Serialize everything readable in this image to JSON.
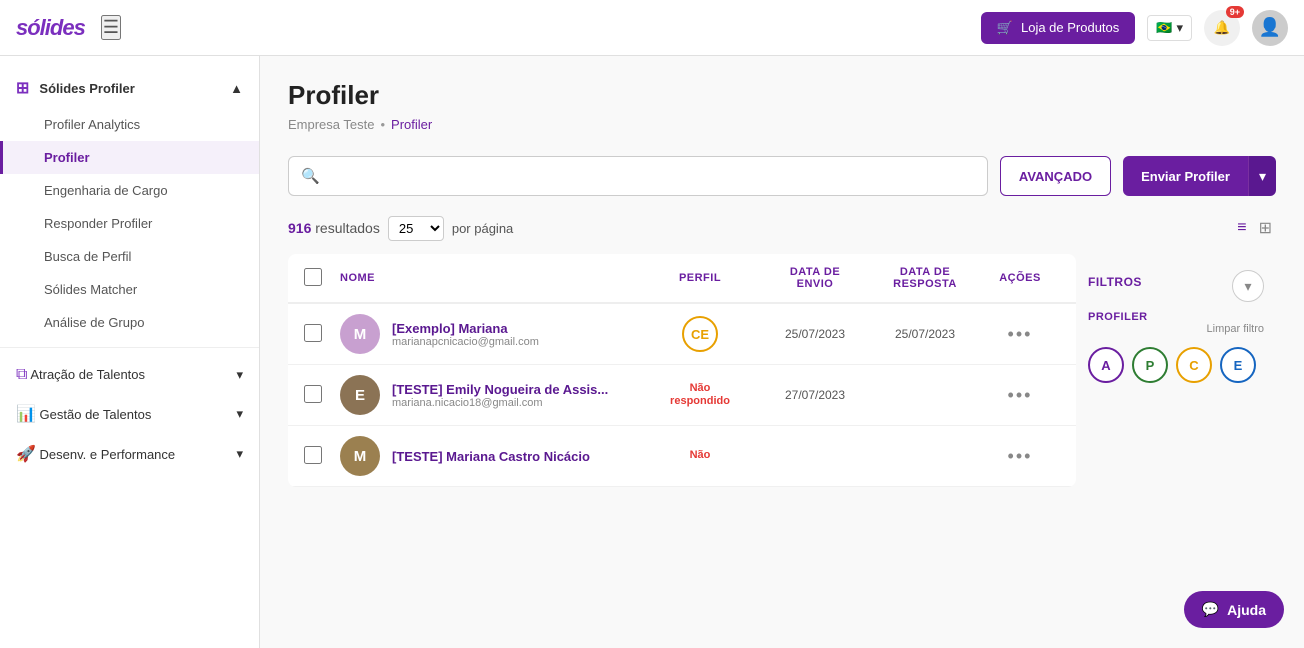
{
  "header": {
    "logo": "sólides",
    "menu_label": "☰",
    "shop_button": "Loja de Produtos",
    "flag_emoji": "🇧🇷",
    "notif_badge": "9+",
    "cursor_icon": "↖"
  },
  "sidebar": {
    "solides_profiler_label": "Sólides Profiler",
    "items": [
      {
        "id": "profiler-analytics",
        "label": "Profiler Analytics",
        "active": false
      },
      {
        "id": "profiler",
        "label": "Profiler",
        "active": true
      },
      {
        "id": "engenharia-de-cargo",
        "label": "Engenharia de Cargo",
        "active": false
      },
      {
        "id": "responder-profiler",
        "label": "Responder Profiler",
        "active": false
      },
      {
        "id": "busca-de-perfil",
        "label": "Busca de Perfil",
        "active": false
      },
      {
        "id": "solides-matcher",
        "label": "Sólides Matcher",
        "active": false
      },
      {
        "id": "analise-de-grupo",
        "label": "Análise de Grupo",
        "active": false
      }
    ],
    "sections": [
      {
        "id": "atracao-de-talentos",
        "label": "Atração de Talentos"
      },
      {
        "id": "gestao-de-talentos",
        "label": "Gestão de Talentos"
      },
      {
        "id": "desenv-e-performance",
        "label": "Desenv. e Performance"
      }
    ]
  },
  "page": {
    "title": "Profiler",
    "breadcrumb_company": "Empresa Teste",
    "breadcrumb_sep": "•",
    "breadcrumb_active": "Profiler"
  },
  "search": {
    "placeholder": "",
    "avancado_label": "AVANÇADO",
    "enviar_label": "Enviar Profiler"
  },
  "results": {
    "count": "916",
    "count_label": "resultados",
    "per_page": "25",
    "per_page_label": "por página"
  },
  "table": {
    "headers": {
      "nome": "NOME",
      "perfil": "PERFIL",
      "data_envio": "DATA DE ENVIO",
      "data_resposta": "DATA DE RESPOSTA",
      "acoes": "AÇÕES"
    },
    "rows": [
      {
        "id": 1,
        "name": "[Exemplo] Mariana",
        "email": "marianapcnicacio@gmail.com",
        "perfil_code": "CE",
        "perfil_type": "badge",
        "data_envio": "25/07/2023",
        "data_resposta": "25/07/2023",
        "avatar_color": "#c8a0d0",
        "avatar_initial": "M"
      },
      {
        "id": 2,
        "name": "[TESTE] Emily Nogueira de Assis...",
        "email": "mariana.nicacio18@gmail.com",
        "perfil_code": "Não respondido",
        "perfil_type": "nao",
        "data_envio": "27/07/2023",
        "data_resposta": "",
        "avatar_color": "#a0a0a0",
        "avatar_initial": "E"
      },
      {
        "id": 3,
        "name": "[TESTE] Mariana Castro Nicácio",
        "email": "",
        "perfil_code": "Não",
        "perfil_type": "nao",
        "data_envio": "",
        "data_resposta": "",
        "avatar_color": "#b0a080",
        "avatar_initial": "M"
      }
    ]
  },
  "filter": {
    "title": "FILTROS",
    "profiler_label": "PROFILER",
    "limpar_label": "Limpar filtro",
    "circles": [
      {
        "letter": "A",
        "css_class": "fc-a"
      },
      {
        "letter": "P",
        "css_class": "fc-p"
      },
      {
        "letter": "C",
        "css_class": "fc-c"
      },
      {
        "letter": "E",
        "css_class": "fc-e"
      }
    ]
  },
  "ajuda": {
    "label": "Ajuda"
  }
}
